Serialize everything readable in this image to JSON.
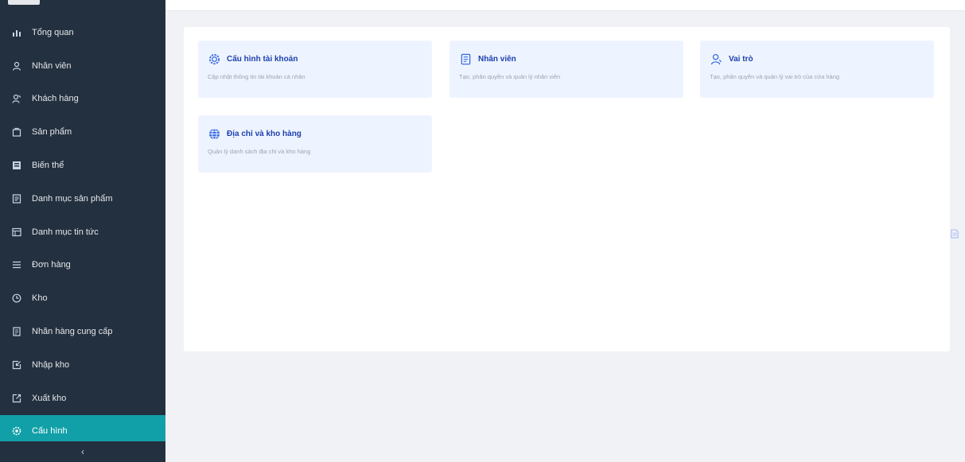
{
  "sidebar": {
    "items": [
      {
        "label": "Tổng quan",
        "icon": "bar-chart-icon"
      },
      {
        "label": "Nhân viên",
        "icon": "user-icon"
      },
      {
        "label": "Khách hàng",
        "icon": "customer-icon"
      },
      {
        "label": "Sản phẩm",
        "icon": "box-icon"
      },
      {
        "label": "Biến thể",
        "icon": "variant-icon"
      },
      {
        "label": "Danh mục sản phẩm",
        "icon": "category-icon"
      },
      {
        "label": "Danh mục tin tức",
        "icon": "news-icon"
      },
      {
        "label": "Đơn hàng",
        "icon": "list-icon"
      },
      {
        "label": "Kho",
        "icon": "warehouse-icon"
      },
      {
        "label": "Nhãn hàng cung cấp",
        "icon": "brand-icon"
      },
      {
        "label": "Nhập kho",
        "icon": "import-icon"
      },
      {
        "label": "Xuất kho",
        "icon": "export-icon"
      },
      {
        "label": "Cấu hình",
        "icon": "settings-icon",
        "active": true
      }
    ],
    "collapse_symbol": "‹"
  },
  "cards": [
    {
      "title": "Cấu hình tài khoản",
      "desc": "Cập nhật thông tin tài khoản cá nhân",
      "icon": "gear-icon"
    },
    {
      "title": "Nhân viên",
      "desc": "Tạo, phân quyền và quản lý nhân viên",
      "icon": "staff-icon"
    },
    {
      "title": "Vai trò",
      "desc": "Tạo, phân quyền và quản lý vai trò của cửa hàng",
      "icon": "role-icon"
    },
    {
      "title": "Địa chỉ và kho hàng",
      "desc": "Quản lý danh sách địa chỉ và kho hàng",
      "icon": "globe-icon"
    }
  ],
  "colors": {
    "sidebar_bg": "#23303f",
    "active_bg": "#12a0a8",
    "card_bg": "#eef4ff",
    "accent": "#3b6fe0"
  }
}
